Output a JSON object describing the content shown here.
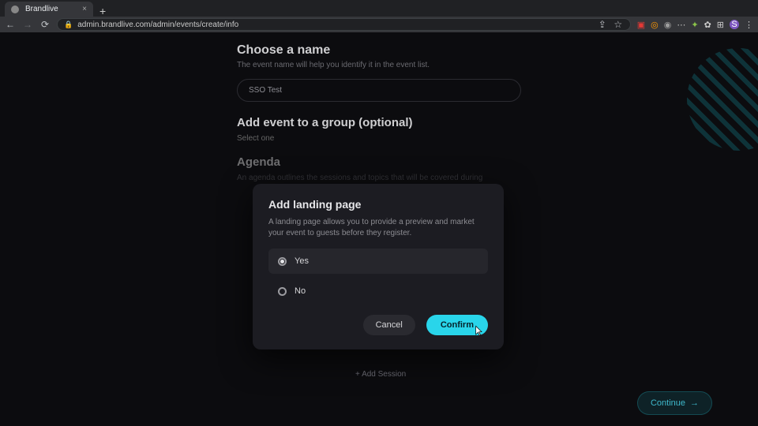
{
  "browser": {
    "tab_title": "Brandlive",
    "url": "admin.brandlive.com/admin/events/create/info"
  },
  "page": {
    "choose_name": {
      "title": "Choose a name",
      "sub": "The event name will help you identify it in the event list.",
      "value": "SSO Test"
    },
    "group": {
      "title": "Add event to a group (optional)",
      "select_label": "Select one"
    },
    "agenda_title": "Agenda",
    "agenda_sub": "An agenda outlines the sessions and topics that will be covered during",
    "add_session": "+ Add Session",
    "continue": "Continue"
  },
  "modal": {
    "title": "Add landing page",
    "desc": "A landing page allows you to provide a preview and market your event to guests before they register.",
    "yes": "Yes",
    "no": "No",
    "cancel": "Cancel",
    "confirm": "Confirm"
  }
}
